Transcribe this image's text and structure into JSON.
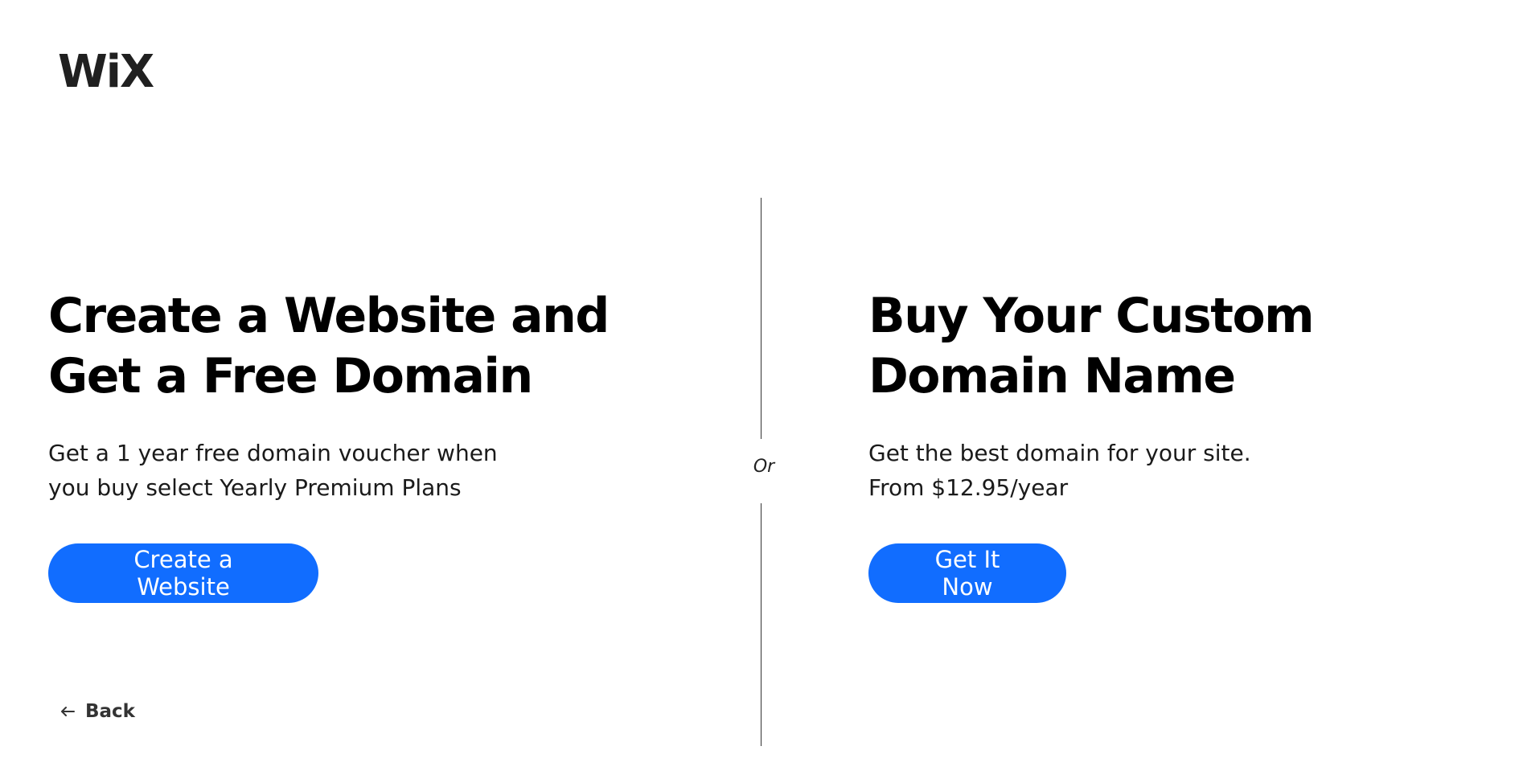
{
  "brand": {
    "logo_text": "WiX"
  },
  "left": {
    "headline_line1": "Create a Website and",
    "headline_line2": "Get a Free Domain",
    "sub_line1": "Get a 1 year free domain voucher when",
    "sub_line2": "you buy select Yearly Premium Plans",
    "button_label": "Create a Website"
  },
  "divider": {
    "label": "Or"
  },
  "right": {
    "headline_line1": "Buy Your Custom",
    "headline_line2": "Domain Name",
    "sub_line1": "Get the best domain for your site.",
    "sub_line2": "From $12.95/year",
    "button_label": "Get It Now"
  },
  "nav": {
    "back_label": "Back",
    "back_icon": "arrow-left-icon"
  },
  "colors": {
    "accent": "#116dff",
    "text": "#000000",
    "background": "#ffffff"
  }
}
